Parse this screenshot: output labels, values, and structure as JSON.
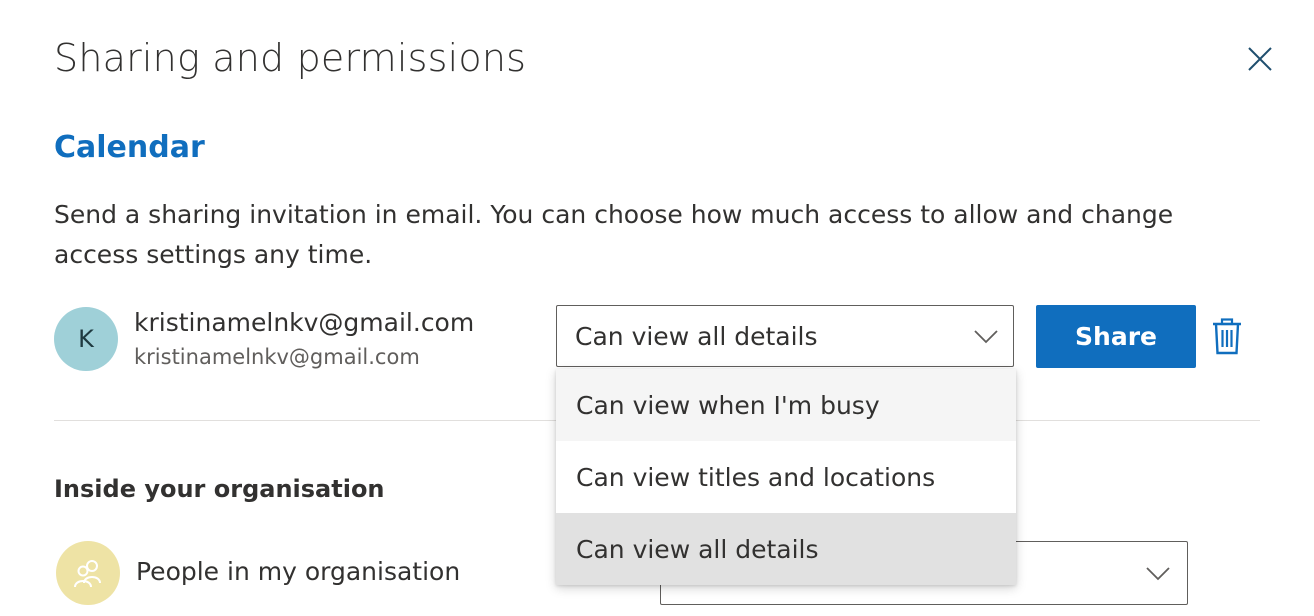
{
  "dialog": {
    "title": "Sharing and permissions",
    "close_icon": "close-icon"
  },
  "calendar": {
    "heading": "Calendar",
    "description": "Send a sharing invitation in email. You can choose how much access to allow and change access settings any time.",
    "accent_color": "#106ebe"
  },
  "invitee": {
    "avatar_initial": "K",
    "avatar_color": "#9fd0d8",
    "name": "kristinamelnkv@gmail.com",
    "email": "kristinamelnkv@gmail.com",
    "permission_selected": "Can view all details",
    "share_label": "Share",
    "delete_icon": "trash-icon"
  },
  "permission_menu": {
    "options": [
      "Can view when I'm busy",
      "Can view titles and locations",
      "Can view all details"
    ],
    "hovered_index": 0,
    "selected_index": 2
  },
  "organisation": {
    "heading": "Inside your organisation",
    "group_label": "People in my organisation",
    "group_icon": "people-icon",
    "avatar_color": "#eee3a5"
  }
}
